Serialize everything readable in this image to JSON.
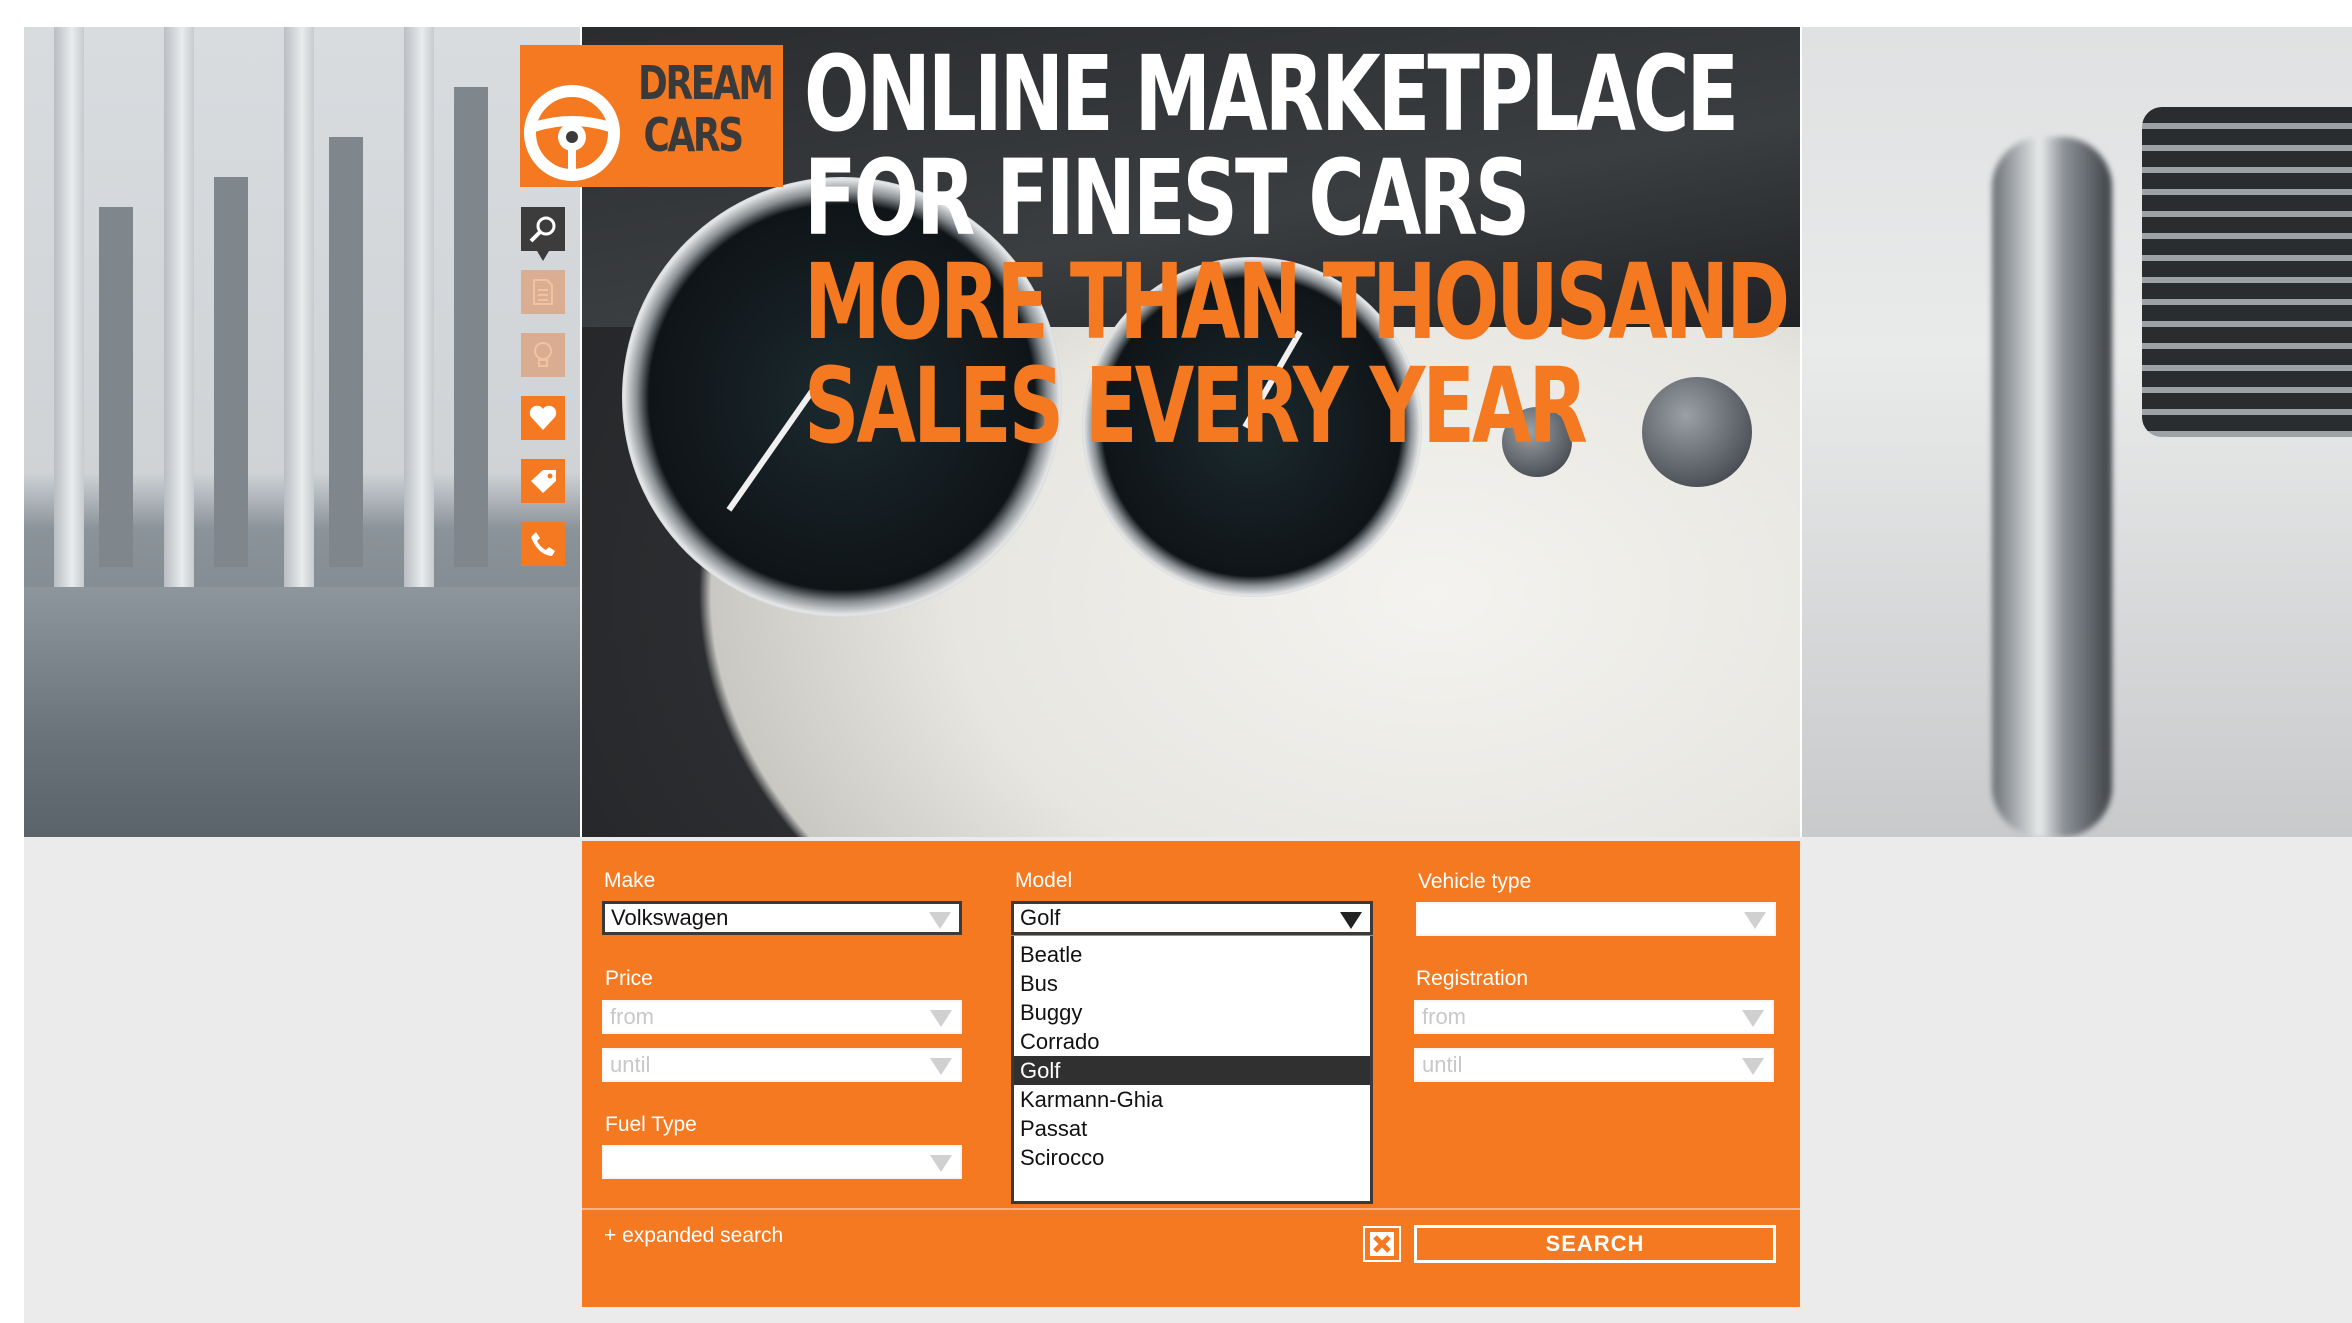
{
  "brand": {
    "line1": "DREAM",
    "line2": "CARS",
    "accent_color": "#f47920",
    "dark_color": "#3a3a3a"
  },
  "nav": [
    {
      "icon": "search-icon",
      "state": "active"
    },
    {
      "icon": "document-icon",
      "state": "inactive"
    },
    {
      "icon": "lightbulb-icon",
      "state": "inactive"
    },
    {
      "icon": "heart-icon",
      "state": "default"
    },
    {
      "icon": "tag-icon",
      "state": "default"
    },
    {
      "icon": "phone-icon",
      "state": "default"
    }
  ],
  "headline": {
    "line1": "ONLINE MARKETPLACE",
    "line2": "FOR FINEST CARS",
    "line3": "MORE THAN THOUSAND",
    "line4": "SALES EVERY YEAR"
  },
  "search": {
    "make": {
      "label": "Make",
      "value": "Volkswagen"
    },
    "model": {
      "label": "Model",
      "value": "Golf",
      "options": [
        "Beatle",
        "Bus",
        "Buggy",
        "Corrado",
        "Golf",
        "Karmann-Ghia",
        "Passat",
        "Scirocco"
      ],
      "highlighted": "Golf"
    },
    "vehicle_type": {
      "label": "Vehicle type",
      "value": ""
    },
    "price": {
      "label": "Price",
      "from_placeholder": "from",
      "until_placeholder": "until"
    },
    "registration": {
      "label": "Registration",
      "from_placeholder": "from",
      "until_placeholder": "until"
    },
    "fuel_type": {
      "label": "Fuel Type",
      "value": ""
    },
    "expanded_link": "+ expanded search",
    "reset_icon": "close-icon",
    "search_button": "SEARCH"
  }
}
